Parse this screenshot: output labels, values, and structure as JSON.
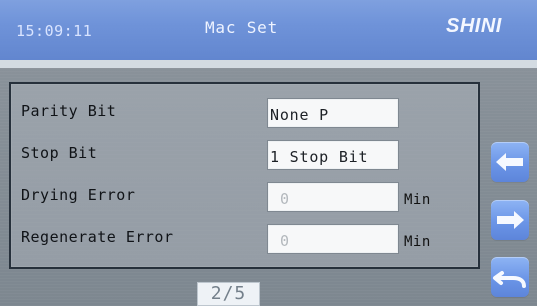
{
  "header": {
    "time": "15:09:11",
    "title": "Mac Set",
    "brand": "SHINI"
  },
  "settings": {
    "parity_bit": {
      "label": "Parity Bit",
      "value": "None P"
    },
    "stop_bit": {
      "label": "Stop Bit",
      "value": "1 Stop Bit"
    },
    "drying_error": {
      "label": "Drying Error",
      "value": "0",
      "unit": "Min"
    },
    "regenerate_error": {
      "label": "Regenerate Error",
      "value": "0",
      "unit": "Min"
    }
  },
  "navigation": {
    "page_indicator": "2/5",
    "left_icon": "arrow-left-icon",
    "right_icon": "arrow-right-icon",
    "back_icon": "return-arrow-icon"
  },
  "colors": {
    "header": "#6f93d9",
    "panel": "#979fa8",
    "field": "#f7f8f9",
    "button": "#6b95e7"
  }
}
